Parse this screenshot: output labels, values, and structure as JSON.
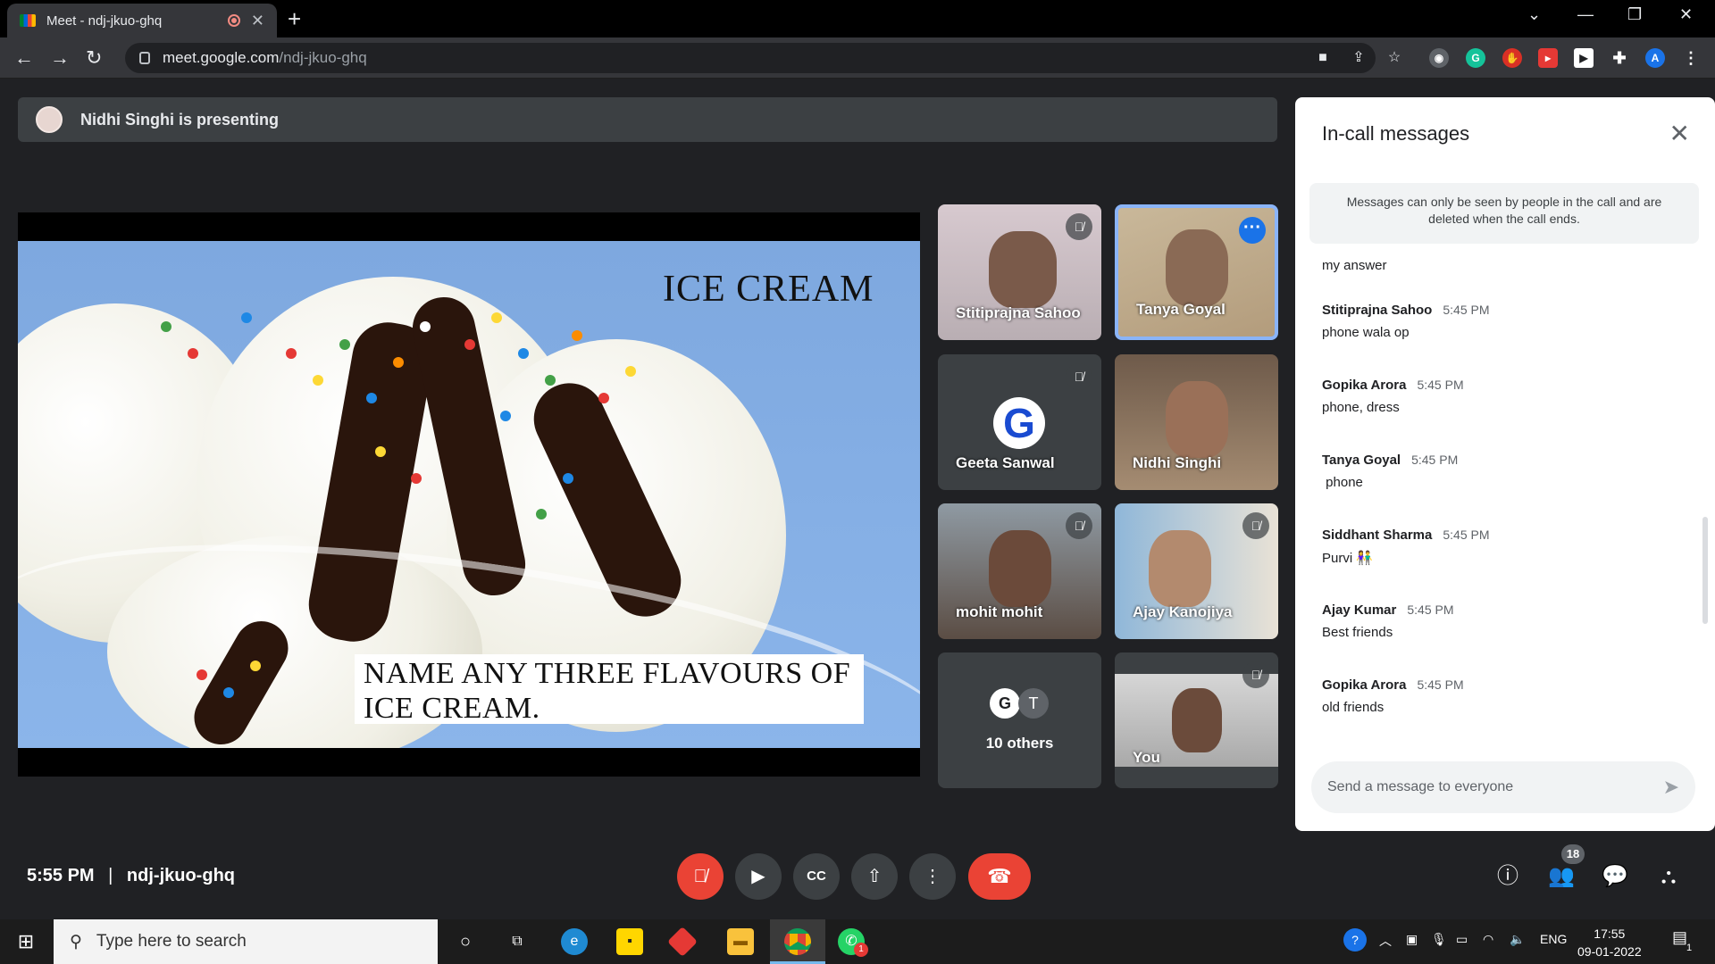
{
  "browser": {
    "tab_title": "Meet - ndj-jkuo-ghq",
    "url_host": "meet.google.com",
    "url_path": "/ndj-jkuo-ghq",
    "profile_initial": "A"
  },
  "presenting": {
    "label": "Nidhi Singhi is presenting"
  },
  "slide": {
    "title": "ICE CREAM",
    "question": "NAME ANY THREE FLAVOURS OF ICE CREAM."
  },
  "tiles": [
    {
      "name": "Stitiprajna Sahoo",
      "muted": true
    },
    {
      "name": "Tanya Goyal",
      "active": true
    },
    {
      "name": "Geeta Sanwal",
      "muted": true,
      "avatar_letter": "G"
    },
    {
      "name": "Nidhi Singhi"
    },
    {
      "name": "mohit mohit",
      "muted": true
    },
    {
      "name": "Ajay Kanojiya",
      "muted": true
    },
    {
      "name": "10 others",
      "avatar_letters": [
        "G",
        "T"
      ]
    },
    {
      "name": "You",
      "muted": true
    }
  ],
  "chat": {
    "title": "In-call messages",
    "notice": "Messages can only be seen by people in the call and are deleted when the call ends.",
    "first_text": "my answer",
    "messages": [
      {
        "sender": "Stitiprajna Sahoo",
        "time": "5:45 PM",
        "text": "phone wala op"
      },
      {
        "sender": "Gopika Arora",
        "time": "5:45 PM",
        "text": "phone, dress"
      },
      {
        "sender": "Tanya Goyal",
        "time": "5:45 PM",
        "text": " phone"
      },
      {
        "sender": "Siddhant Sharma",
        "time": "5:45 PM",
        "text": "Purvi 👫"
      },
      {
        "sender": "Ajay Kumar",
        "time": "5:45 PM",
        "text": "Best friends"
      },
      {
        "sender": "Gopika Arora",
        "time": "5:45 PM",
        "text": "old friends"
      }
    ],
    "composer_placeholder": "Send a message to everyone"
  },
  "footer": {
    "time": "5:55 PM",
    "separator": "|",
    "meeting_code": "ndj-jkuo-ghq",
    "participants_count": "18"
  },
  "taskbar": {
    "search_placeholder": "Type here to search",
    "lang": "ENG",
    "time": "17:55",
    "date": "09-01-2022",
    "whatsapp_badge": "1",
    "notif_count": "1"
  },
  "colors": {
    "meet_bg": "#202124",
    "tile_bg": "#3c4043",
    "accent_blue": "#8ab4f8",
    "end_call_red": "#ea4335"
  }
}
